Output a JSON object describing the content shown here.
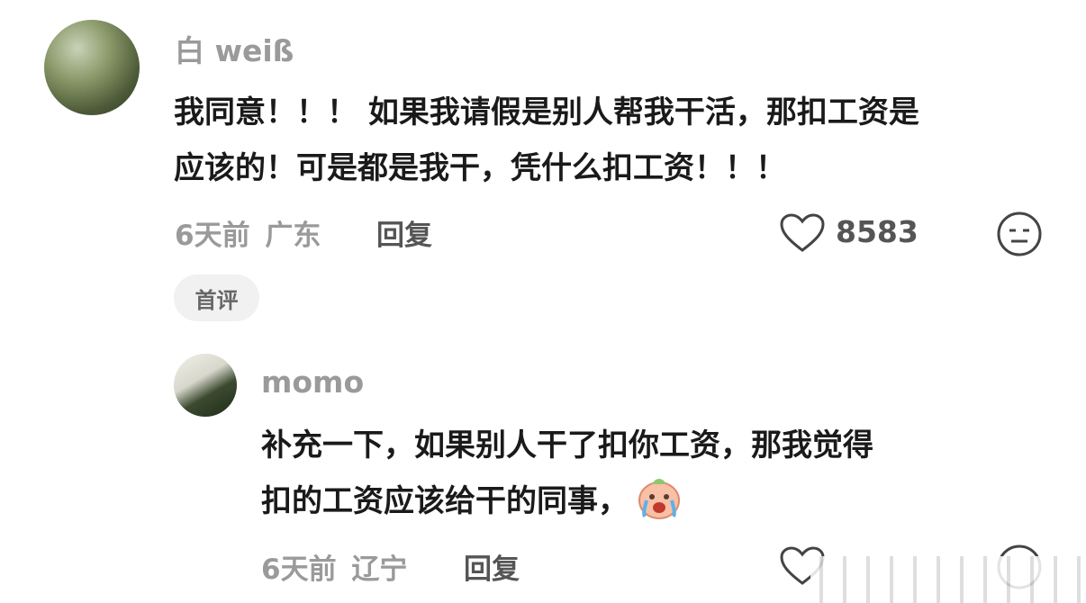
{
  "comments": [
    {
      "username": "白 weiß",
      "text_line1": "我同意！！！ 如果我请假是别人帮我干活，那扣工资是",
      "text_line2": "应该的！可是都是我干，凭什么扣工资！！！",
      "time": "6天前",
      "location": "广东",
      "reply_label": "回复",
      "likes": "8583",
      "tag": "首评"
    },
    {
      "username": "momo",
      "text_line1": "补充一下，如果别人干了扣你工资，那我觉得",
      "text_line2": "扣的工资应该给干的同事，",
      "time": "6天前",
      "location": "辽宁",
      "reply_label": "回复"
    }
  ],
  "icons": {
    "like": "heart-icon",
    "dislike": "neutral-face-icon",
    "emoji": "crying-peach-emoji"
  },
  "colors": {
    "meta_gray": "#9a9a9a",
    "text": "#1a1a1a",
    "tag_bg": "#f1f1f1"
  }
}
